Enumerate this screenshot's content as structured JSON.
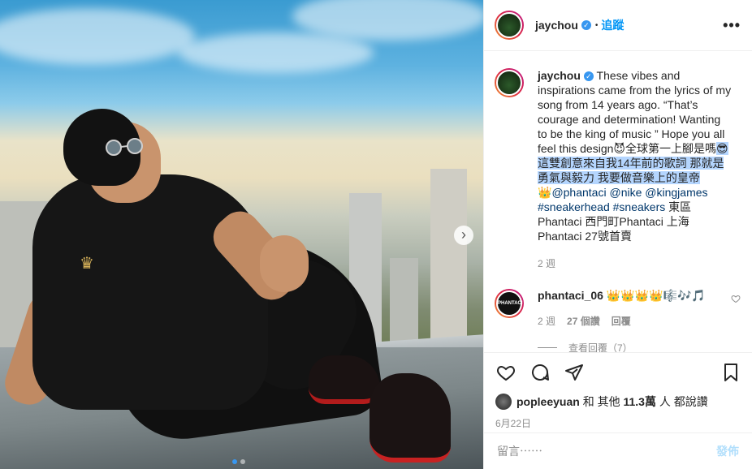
{
  "post": {
    "username": "jaychou",
    "follow_label": "追蹤",
    "bullet": "•",
    "more_icon": "more-horizontal-icon",
    "verified_mark": "✓"
  },
  "caption": {
    "username": "jaychou",
    "text_before_selection": "These vibes and inspirations came from the lyrics of my song from 14 years ago. “That’s courage and determination! Wanting to be the king of music ” Hope you all feel this design😈全球第一上腳是嗎",
    "selected_text": "😎這雙創意來自我14年前的歌詞 那就是勇氣與毅力 我要做音樂上的皇帝",
    "crown_emoji": "👑",
    "mentions": [
      "@phantaci",
      "@nike",
      "@kingjames"
    ],
    "hashtags": [
      "#sneakerhead",
      "#sneakers"
    ],
    "text_after": "東區Phantaci 西門町Phantaci 上海Phantaci 27號首賣",
    "timestamp": "2 週"
  },
  "comment": {
    "username": "phantaci_06",
    "avatar_text": "PHANTACI",
    "text": "👑👑👑👑🎼🎶🎵",
    "timestamp": "2 週",
    "likes": "27 個讚",
    "reply_label": "回覆",
    "view_replies": "查看回覆（7）"
  },
  "actions": {
    "icons": [
      "heart-icon",
      "comment-icon",
      "share-icon",
      "bookmark-icon"
    ]
  },
  "likes": {
    "user": "popleeyuan",
    "connector": "和 其他",
    "count": "11.3萬",
    "suffix": "人 都說讚"
  },
  "date": "6月22日",
  "add_comment": {
    "placeholder": "留言⋯⋯",
    "post_label": "發佈"
  },
  "photo": {
    "next_arrow": "›",
    "carousel_count": 2,
    "active_index": 0
  },
  "colors": {
    "link": "#00376b",
    "accent": "#0095f6",
    "selection": "#b4d5fe",
    "post_disabled": "#b2dffc"
  }
}
